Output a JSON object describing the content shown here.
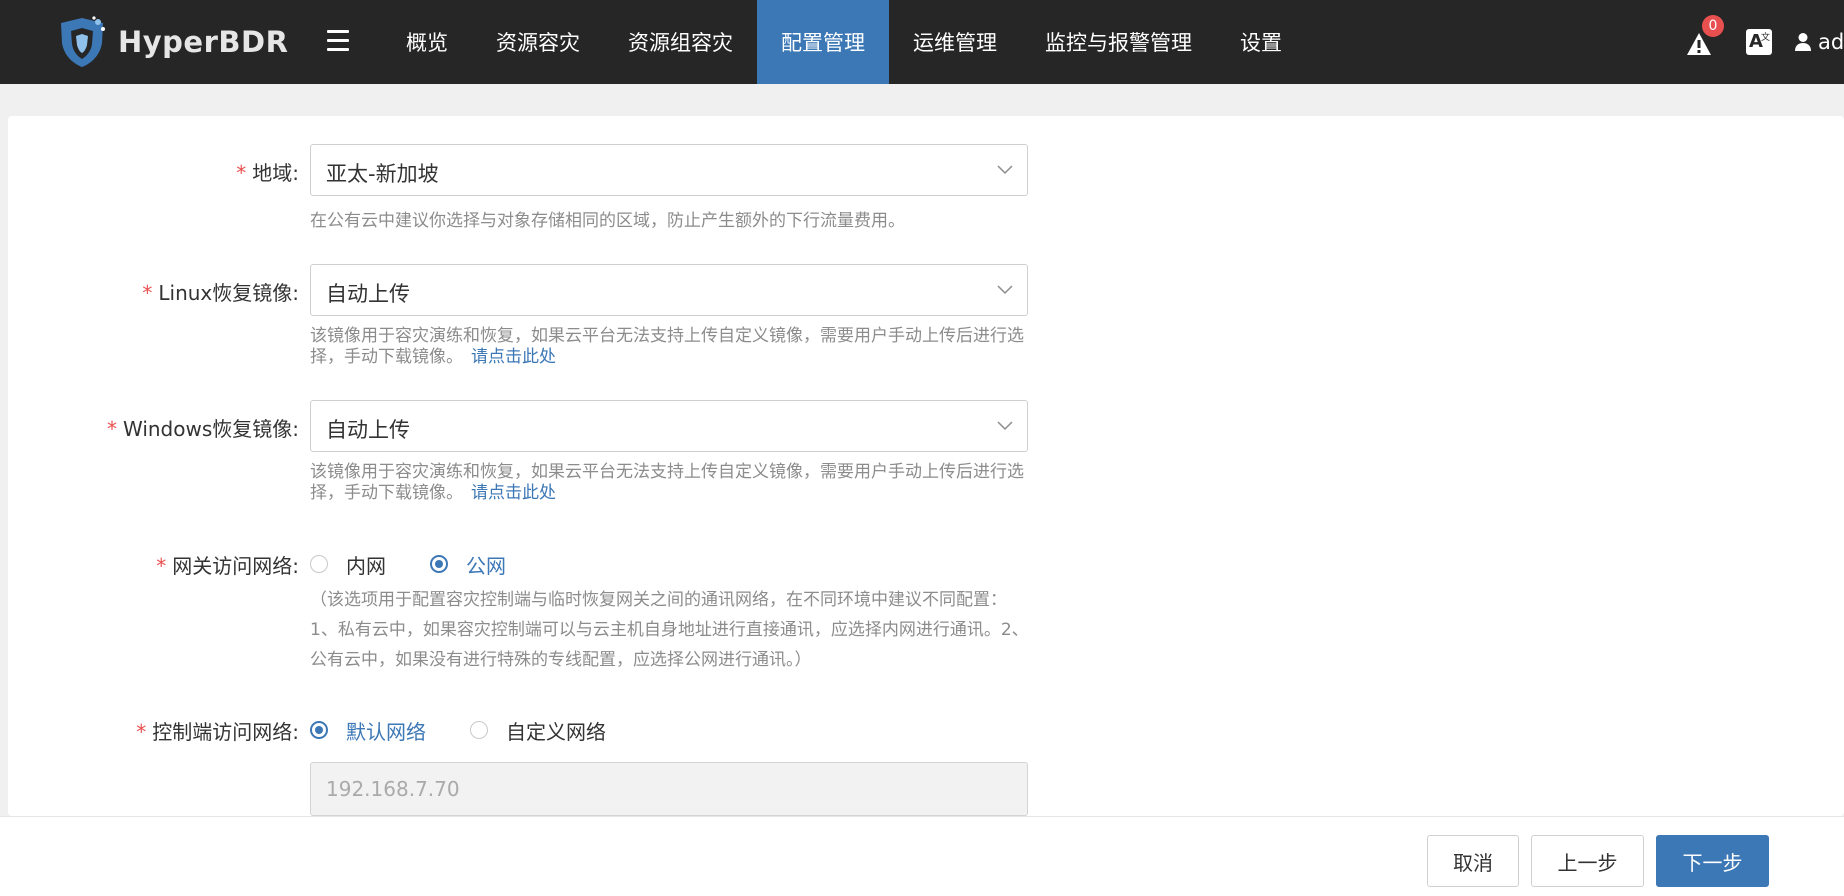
{
  "header": {
    "logo_text": "HyperBDR",
    "nav": [
      {
        "label": "概览",
        "active": false
      },
      {
        "label": "资源容灾",
        "active": false
      },
      {
        "label": "资源组容灾",
        "active": false
      },
      {
        "label": "配置管理",
        "active": true
      },
      {
        "label": "运维管理",
        "active": false
      },
      {
        "label": "监控与报警管理",
        "active": false
      },
      {
        "label": "设置",
        "active": false
      }
    ],
    "alert_count": "0",
    "user_name": "admin",
    "accent_color": "#3c77b6",
    "badge_color": "#e8504f"
  },
  "form": {
    "region": {
      "label": "地域:",
      "value": "亚太-新加坡",
      "help": "在公有云中建议你选择与对象存储相同的区域，防止产生额外的下行流量费用。"
    },
    "linux_image": {
      "label": "Linux恢复镜像:",
      "value": "自动上传",
      "help": "该镜像用于容灾演练和恢复，如果云平台无法支持上传自定义镜像，需要用户手动上传后进行选择，手动下载镜像。",
      "link": "请点击此处"
    },
    "windows_image": {
      "label": "Windows恢复镜像:",
      "value": "自动上传",
      "help": "该镜像用于容灾演练和恢复，如果云平台无法支持上传自定义镜像，需要用户手动上传后进行选择，手动下载镜像。",
      "link": "请点击此处"
    },
    "gateway_network": {
      "label": "网关访问网络:",
      "options": [
        "内网",
        "公网"
      ],
      "selected": "公网",
      "note": "（该选项用于配置容灾控制端与临时恢复网关之间的通讯网络，在不同环境中建议不同配置：1、私有云中，如果容灾控制端可以与云主机自身地址进行直接通讯，应选择内网进行通讯。2、公有云中，如果没有进行特殊的专线配置，应选择公网进行通讯。）"
    },
    "controller_network": {
      "label": "控制端访问网络:",
      "options": [
        "默认网络",
        "自定义网络"
      ],
      "selected": "默认网络",
      "ip_value": "192.168.7.70"
    }
  },
  "footer": {
    "cancel": "取消",
    "prev": "上一步",
    "next": "下一步"
  }
}
